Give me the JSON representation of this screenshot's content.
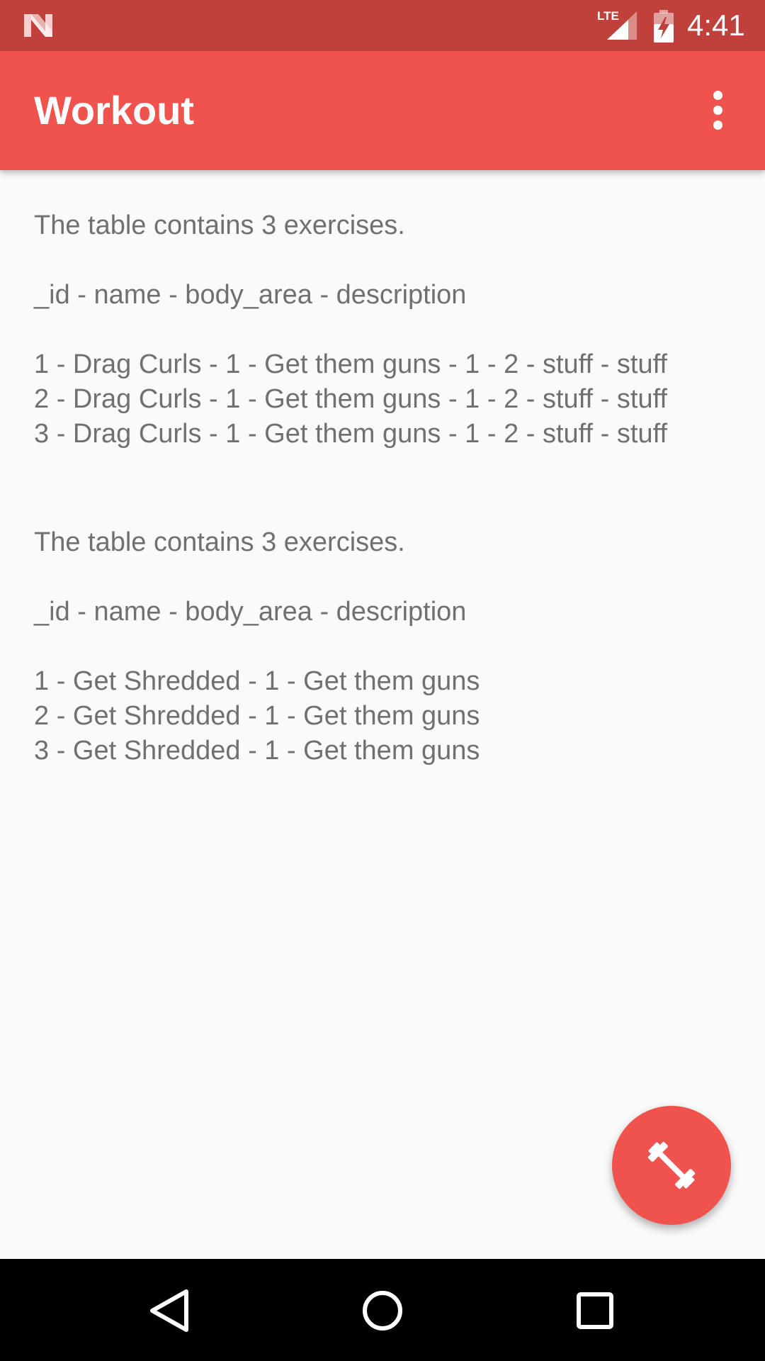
{
  "status_bar": {
    "time": "4:41",
    "network_label": "LTE",
    "icons": [
      "android-n-icon",
      "lte-signal-icon",
      "battery-charging-icon"
    ],
    "color": "#c0413b"
  },
  "app_bar": {
    "title": "Workout",
    "overflow_icon": "more-vert-icon",
    "color": "#f0534d"
  },
  "content": {
    "exercises_block": {
      "summary": "The table contains 3 exercises.",
      "header": "_id - name - body_area - description",
      "rows": [
        "1 - Drag Curls - 1 - Get them guns - 1 - 2 - stuff - stuff",
        "2 - Drag Curls - 1 - Get them guns - 1 - 2 - stuff - stuff",
        "3 - Drag Curls - 1 - Get them guns - 1 - 2 - stuff - stuff"
      ]
    },
    "workouts_block": {
      "summary": "The table contains 3 exercises.",
      "header": "_id - name - body_area - description",
      "rows": [
        "1 - Get Shredded - 1 - Get them guns",
        "2 - Get Shredded - 1 - Get them guns",
        "3 - Get Shredded - 1 - Get them guns"
      ]
    },
    "text_color": "#707070"
  },
  "fab": {
    "icon": "dumbbell-icon",
    "color": "#f0534d"
  },
  "nav_bar": {
    "icons": [
      "back-icon",
      "home-icon",
      "recents-icon"
    ]
  }
}
